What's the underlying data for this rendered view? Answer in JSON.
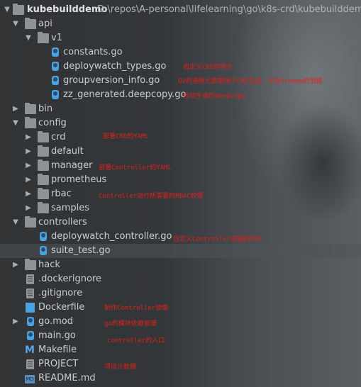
{
  "project": {
    "name": "kubebuilddemo",
    "path": "D:\\repos\\A-personal\\lifelearning\\go\\k8s-crd\\kubebuilddemo"
  },
  "tree": {
    "api": "api",
    "v1": "v1",
    "constants": "constants.go",
    "deploywatch_types": "deploywatch_types.go",
    "groupversion_info": "groupversion_info.go",
    "zz_generated": "zz_generated.deepcopy.go",
    "bin": "bin",
    "config": "config",
    "crd": "crd",
    "default": "default",
    "manager": "manager",
    "prometheus": "prometheus",
    "rbac": "rbac",
    "samples": "samples",
    "controllers": "controllers",
    "deploywatch_controller": "deploywatch_controller.go",
    "suite_test": "suite_test.go",
    "hack": "hack",
    "dockerignore": ".dockerignore",
    "gitignore": ".gitignore",
    "dockerfile": "Dockerfile",
    "gomod": "go.mod",
    "maingo": "main.go",
    "makefile": "Makefile",
    "projectfile": "PROJECT",
    "readme": "README.md"
  },
  "annotations": {
    "types": "自定义CRD的地方",
    "groupversion": "GV的通用元数据用于CRD生成，以及Schema的创建",
    "deepcopy": "自动生成的deepcopy",
    "crd": "部署CRD的YAML",
    "manager": "部署Controller的YAML",
    "rbac": "Controller运行所需要的RBAC权限",
    "controller": "自定义Controller逻辑的地方",
    "dockerfile": "制作Controller镜像",
    "gomod": "go的模块依赖管理",
    "maingo": "controller的入口",
    "project": "项目元数据"
  },
  "icons": {
    "folder": "folder-icon",
    "go": "go-file-icon",
    "file": "file-icon",
    "docker": "docker-file-icon",
    "makefile": "makefile-icon",
    "markdown": "markdown-icon"
  },
  "colors": {
    "annotation": "#e0211a",
    "selected_row": "#4e5458"
  }
}
